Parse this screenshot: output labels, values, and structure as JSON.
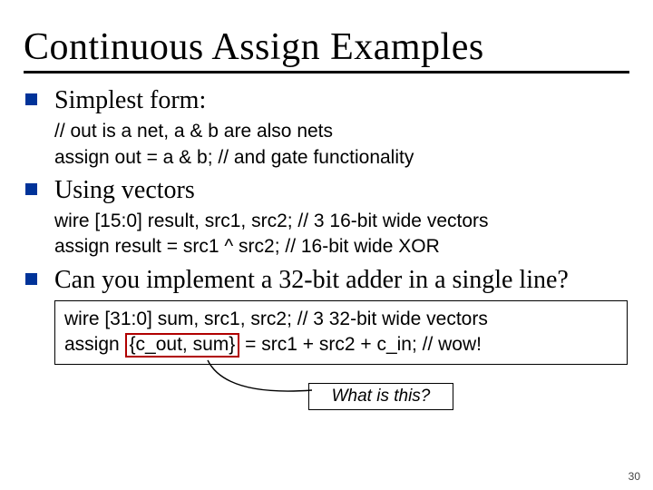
{
  "title": "Continuous Assign Examples",
  "bullets": {
    "b1": {
      "head": "Simplest form:",
      "code1": "// out is a net, a & b are also nets",
      "code2": "assign out = a & b; // and gate functionality"
    },
    "b2": {
      "head": "Using vectors",
      "code1": "wire [15:0] result, src1, src2;  // 3 16-bit wide vectors",
      "code2": "assign result = src1 ^ src2;     // 16-bit wide XOR"
    },
    "b3": {
      "head": "Can you implement a 32-bit adder in a single line?",
      "code1": "wire [31:0] sum, src1, src2;  // 3 32-bit wide vectors",
      "code2a": "assign ",
      "code2_box": "{c_out, sum}",
      "code2b": " = src1 + src2 + c_in;   // wow!"
    }
  },
  "callout": "What is this?",
  "page_number": "30"
}
